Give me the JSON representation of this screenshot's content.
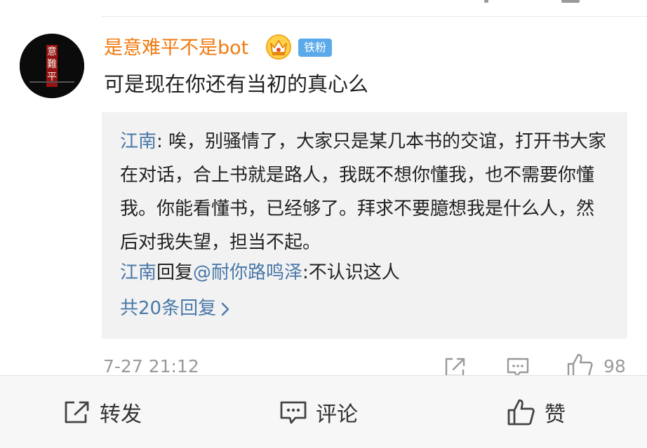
{
  "comment": {
    "username": "是意难平不是bot",
    "fan_badge": "铁粉",
    "text": "可是现在你还有当初的真心么",
    "timestamp": "7-27 21:12",
    "like_count": "98",
    "avatar_text": "意難平"
  },
  "reply_box": {
    "first_reply": {
      "author": "江南",
      "separator": ": ",
      "text": "唉，别骚情了，大家只是某几本书的交谊，打开书大家在对话，合上书就是路人，我既不想你懂我，也不需要你懂我。你能看懂书，已经够了。拜求不要臆想我是什么人，然后对我失望，担当不起。"
    },
    "second_reply": {
      "author": "江南",
      "verb": "回复",
      "mention": "@耐你路鸣泽",
      "text": ":不认识这人"
    },
    "more_replies_label": "共20条回复"
  },
  "bottom_bar": {
    "forward_label": "转发",
    "comment_label": "评论",
    "like_label": "赞"
  },
  "icons": {
    "crown": "crown-icon",
    "share": "share-icon",
    "comment": "comment-icon",
    "like": "thumbs-up-icon",
    "chevron": "chevron-right-icon"
  },
  "colors": {
    "username": "#f07a10",
    "link": "#4a78a8",
    "badge": "#5aa9ea",
    "meta": "#9a9a9a"
  }
}
